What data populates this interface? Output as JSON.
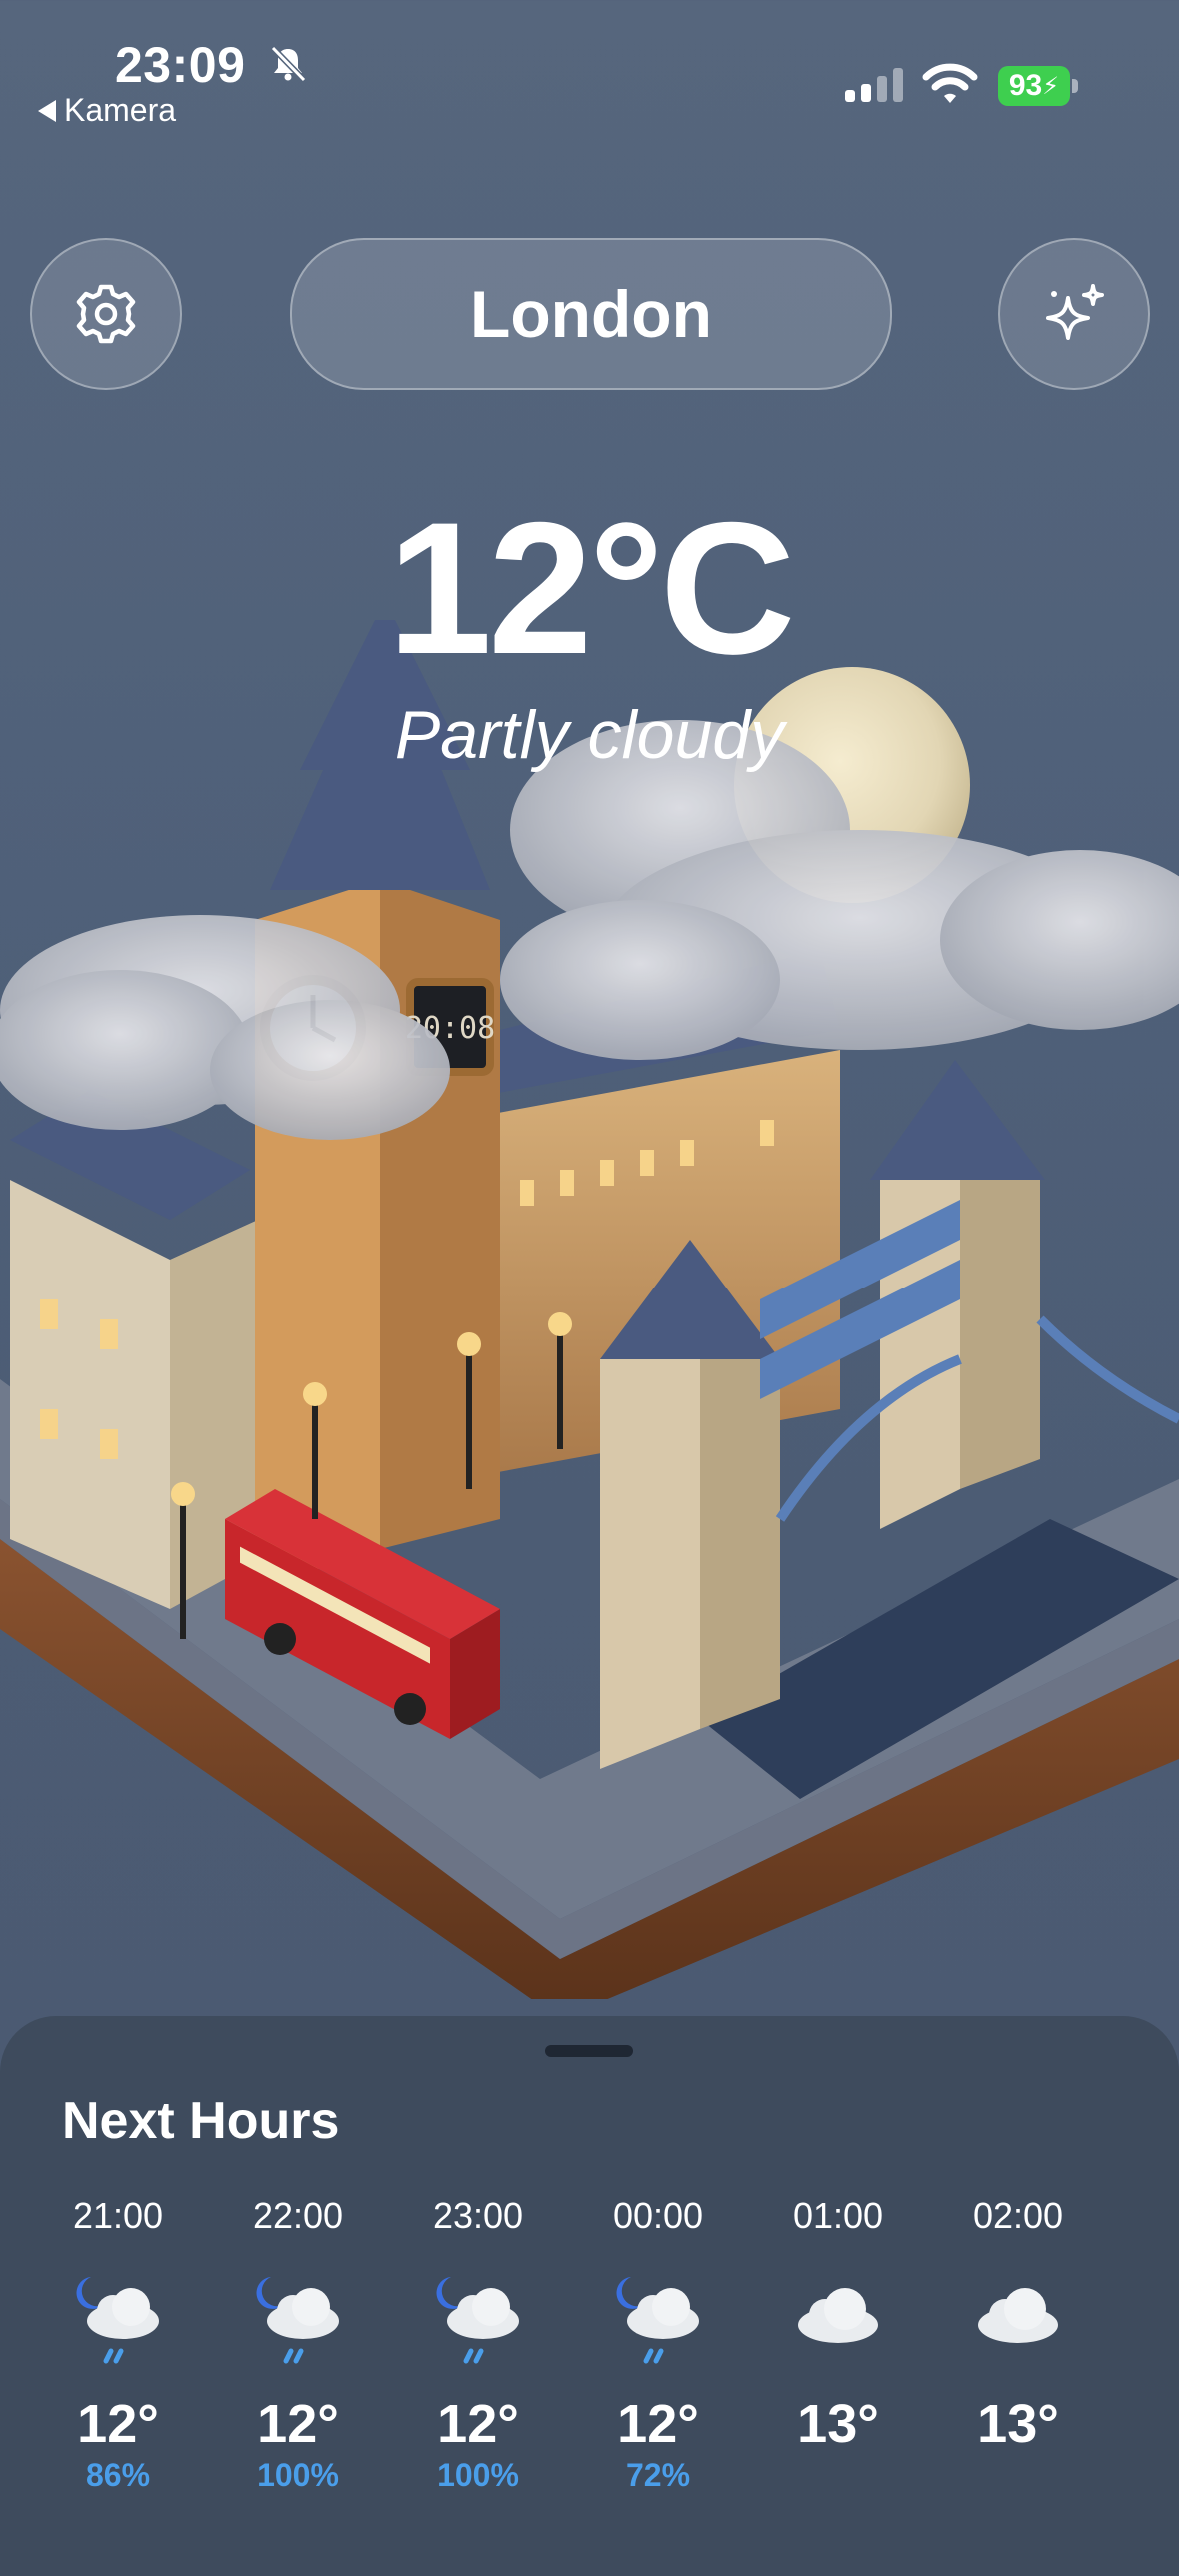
{
  "status_bar": {
    "time": "23:09",
    "back_label": "Kamera",
    "battery": "93"
  },
  "header": {
    "city": "London",
    "settings_icon": "gear-icon",
    "ai_icon": "sparkles-icon"
  },
  "current": {
    "temperature": "12°C",
    "condition": "Partly cloudy"
  },
  "sheet": {
    "title": "Next Hours",
    "hours": [
      {
        "time": "21:00",
        "icon": "moon-cloud-rain-icon",
        "temp": "12°",
        "precip": "86%"
      },
      {
        "time": "22:00",
        "icon": "moon-cloud-rain-icon",
        "temp": "12°",
        "precip": "100%"
      },
      {
        "time": "23:00",
        "icon": "moon-cloud-rain-icon",
        "temp": "12°",
        "precip": "100%"
      },
      {
        "time": "00:00",
        "icon": "moon-cloud-rain-icon",
        "temp": "12°",
        "precip": "72%"
      },
      {
        "time": "01:00",
        "icon": "cloud-icon",
        "temp": "13°",
        "precip": ""
      },
      {
        "time": "02:00",
        "icon": "cloud-icon",
        "temp": "13°",
        "precip": ""
      }
    ]
  },
  "colors": {
    "background": "#4f6079",
    "sheet": "#3e4b5d",
    "precip": "#4a9eea",
    "battery": "#3ecf4f"
  }
}
